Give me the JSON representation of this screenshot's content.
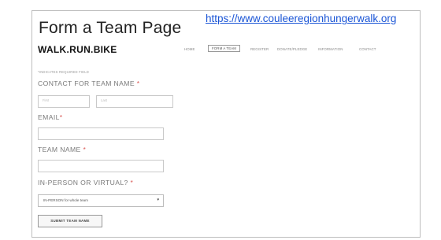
{
  "slide": {
    "title": "Form a Team Page",
    "link": "https://www.couleeregionhungerwalk.org"
  },
  "site": {
    "logo": "WALK.RUN.BIKE",
    "nav": [
      "HOME",
      "FORM A TEAM",
      "REGISTER",
      "DONATE/PLEDGE",
      "INFORMATION",
      "CONTACT"
    ],
    "active_nav": "FORM A TEAM"
  },
  "form": {
    "required_note": "*INDICATES REQUIRED FIELD",
    "contact_label": "CONTACT FOR TEAM NAME",
    "first_placeholder": "First",
    "last_placeholder": "Last",
    "email_label": "EMAIL",
    "team_name_label": "TEAM NAME",
    "mode_label": "IN-PERSON OR VIRTUAL?",
    "mode_selected": "IN-PERSON for whole team",
    "required_star": "*",
    "submit_label": "SUBMIT TEAM NAME"
  },
  "colors": {
    "link": "#1a55d6",
    "required": "#d9534f"
  }
}
